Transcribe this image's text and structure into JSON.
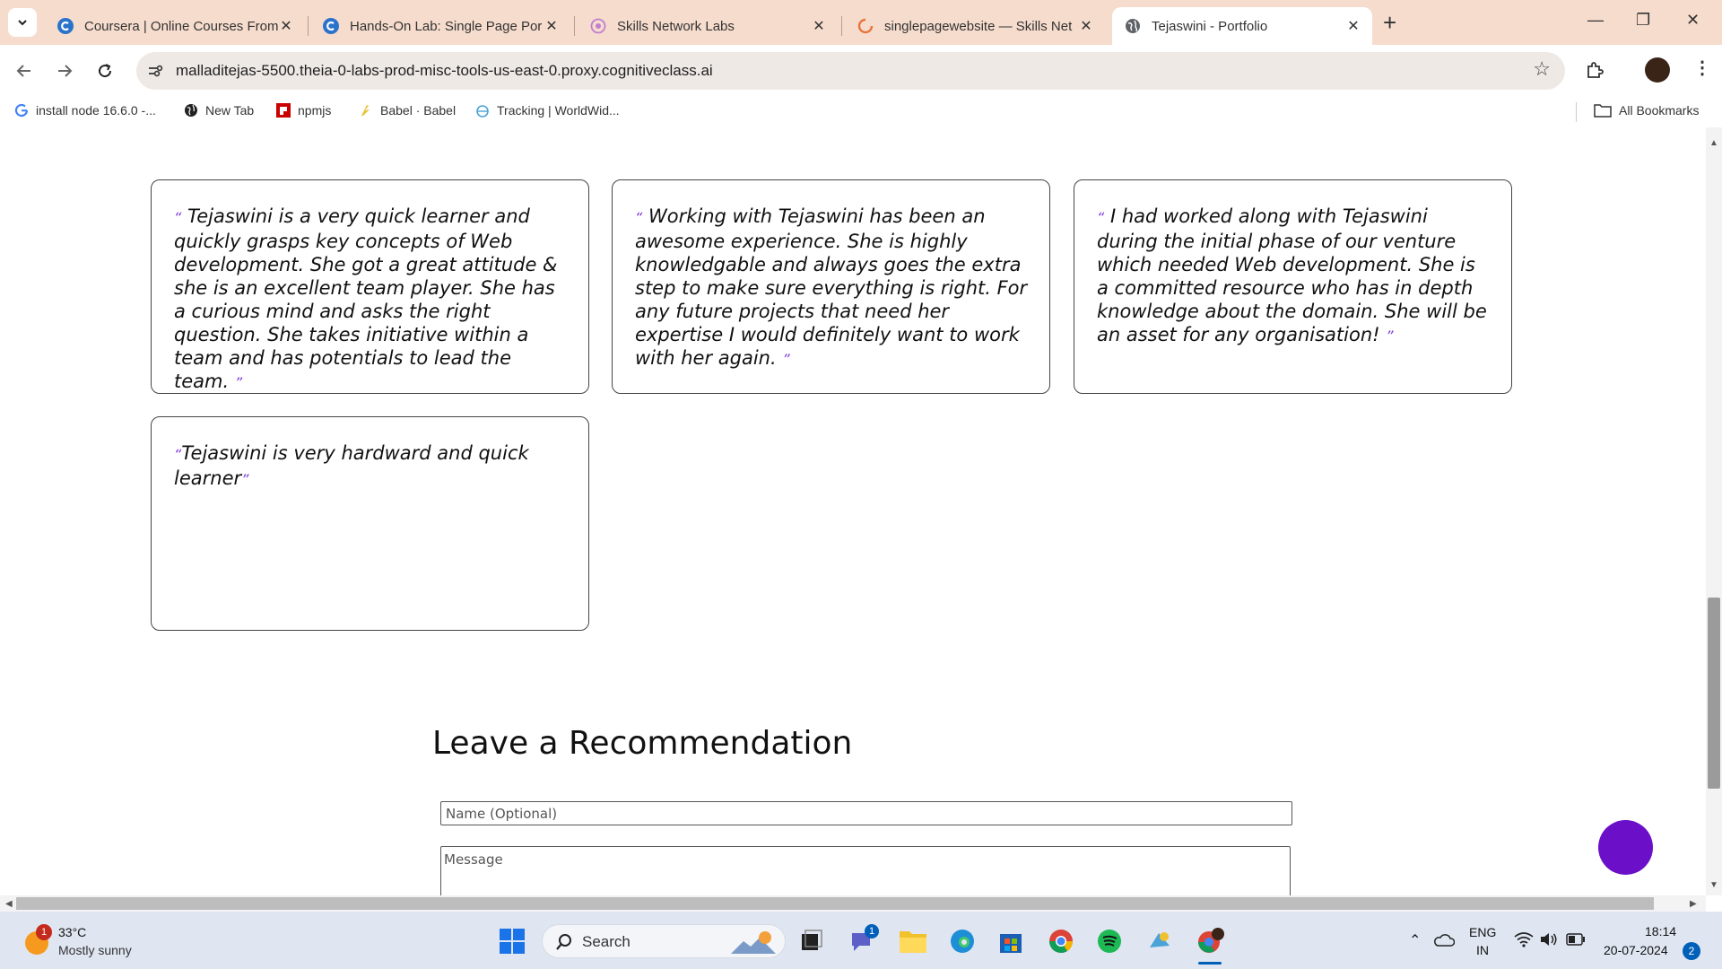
{
  "browser": {
    "tabs": [
      {
        "title": "Coursera | Online Courses From",
        "icon": "coursera-icon",
        "active": false
      },
      {
        "title": "Hands-On Lab: Single Page Por",
        "icon": "coursera-icon",
        "active": false
      },
      {
        "title": "Skills Network Labs",
        "icon": "skills-network-icon",
        "active": false
      },
      {
        "title": "singlepagewebsite — Skills Net",
        "icon": "loading-icon",
        "active": false
      },
      {
        "title": "Tejaswini - Portfolio",
        "icon": "globe-icon",
        "active": true
      }
    ],
    "url": "malladitejas-5500.theia-0-labs-prod-misc-tools-us-east-0.proxy.cognitiveclass.ai",
    "bookmarks": [
      {
        "label": "install node 16.6.0 -...",
        "icon": "google-icon"
      },
      {
        "label": "New Tab",
        "icon": "globe-icon"
      },
      {
        "label": "npmjs",
        "icon": "npm-icon"
      },
      {
        "label": "Babel · Babel",
        "icon": "babel-icon"
      },
      {
        "label": "Tracking | WorldWid...",
        "icon": "tracking-icon"
      }
    ],
    "all_bookmarks": "All Bookmarks"
  },
  "page": {
    "open_quote": "“",
    "close_quote": "”",
    "recommendations": [
      {
        "text": " Tejaswini is a very quick learner and quickly grasps key concepts of Web development. She got a great attitude & she is an excellent team player. She has a curious mind and asks the right question. She takes initiative within a team and has potentials to lead the team. "
      },
      {
        "text": " Working with Tejaswini has been an awesome experience. She is highly knowledgable and always goes the extra step to make sure everything is right. For any future projects that need her expertise I would definitely want to work with her again. "
      },
      {
        "text": " I had worked along with Tejaswini during the initial phase of our venture which needed Web development. She is a committed resource who has in depth knowledge about the domain. She will be an asset for any organisation! "
      },
      {
        "text": "Tejaswini is very hardward and quick learner"
      }
    ],
    "form": {
      "title": "Leave a Recommendation",
      "name_placeholder": "Name (Optional)",
      "message_placeholder": "Message"
    }
  },
  "taskbar": {
    "weather": {
      "temp": "33°C",
      "desc": "Mostly sunny",
      "badge": "1"
    },
    "search_label": "Search",
    "teams_badge": "1",
    "lang_top": "ENG",
    "lang_bottom": "IN",
    "time": "18:14",
    "date": "20-07-2024",
    "notifications": "2"
  },
  "colors": {
    "accent_quote": "#7d3bd6",
    "fab": "#6b0fc9",
    "tabstrip": "#f6dccd"
  }
}
